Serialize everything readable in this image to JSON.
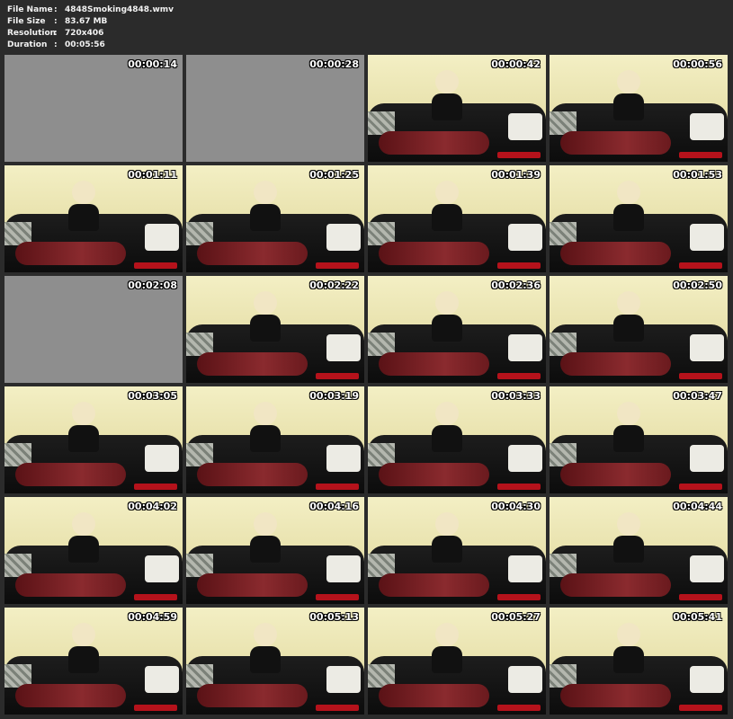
{
  "file_info": {
    "file_name_label": "File Name",
    "file_name_value": "4848Smoking4848.wmv",
    "file_size_label": "File Size",
    "file_size_value": "83.67 MB",
    "resolution_label": "Resolution",
    "resolution_value": "720x406",
    "duration_label": "Duration",
    "duration_value": "00:05:56",
    "separator": ":"
  },
  "thumbnails": [
    {
      "timestamp": "00:00:14",
      "glitch": true
    },
    {
      "timestamp": "00:00:28",
      "glitch": true
    },
    {
      "timestamp": "00:00:42",
      "glitch": false
    },
    {
      "timestamp": "00:00:56",
      "glitch": false
    },
    {
      "timestamp": "00:01:11",
      "glitch": false
    },
    {
      "timestamp": "00:01:25",
      "glitch": false
    },
    {
      "timestamp": "00:01:39",
      "glitch": false
    },
    {
      "timestamp": "00:01:53",
      "glitch": false
    },
    {
      "timestamp": "00:02:08",
      "glitch": true
    },
    {
      "timestamp": "00:02:22",
      "glitch": false
    },
    {
      "timestamp": "00:02:36",
      "glitch": false
    },
    {
      "timestamp": "00:02:50",
      "glitch": false
    },
    {
      "timestamp": "00:03:05",
      "glitch": false
    },
    {
      "timestamp": "00:03:19",
      "glitch": false
    },
    {
      "timestamp": "00:03:33",
      "glitch": false
    },
    {
      "timestamp": "00:03:47",
      "glitch": false
    },
    {
      "timestamp": "00:04:02",
      "glitch": false
    },
    {
      "timestamp": "00:04:16",
      "glitch": false
    },
    {
      "timestamp": "00:04:30",
      "glitch": false
    },
    {
      "timestamp": "00:04:44",
      "glitch": false
    },
    {
      "timestamp": "00:04:59",
      "glitch": false
    },
    {
      "timestamp": "00:05:13",
      "glitch": false
    },
    {
      "timestamp": "00:05:27",
      "glitch": false
    },
    {
      "timestamp": "00:05:41",
      "glitch": false
    }
  ],
  "colors": {
    "background": "#2b2b2b",
    "text": "#f2f2f2"
  }
}
